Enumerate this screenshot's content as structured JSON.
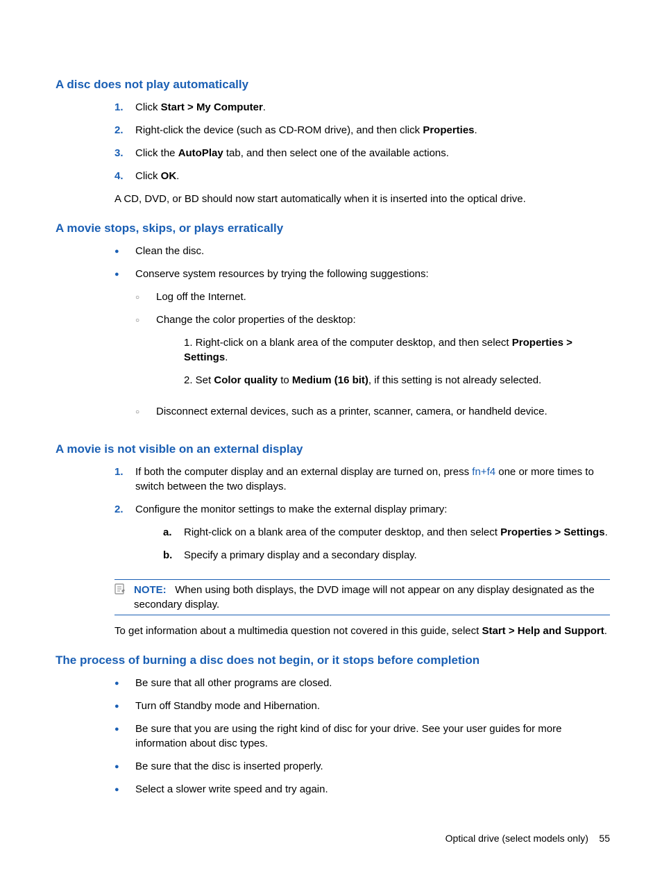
{
  "sections": {
    "s1": {
      "heading": "A disc does not play automatically",
      "steps": {
        "1": {
          "marker": "1.",
          "pre": "Click ",
          "bold": "Start > My Computer",
          "post": "."
        },
        "2": {
          "marker": "2.",
          "pre": "Right-click the device (such as CD-ROM drive), and then click ",
          "bold": "Properties",
          "post": "."
        },
        "3": {
          "marker": "3.",
          "pre": "Click the ",
          "bold": "AutoPlay",
          "post": " tab, and then select one of the available actions."
        },
        "4": {
          "marker": "4.",
          "pre": "Click ",
          "bold": "OK",
          "post": "."
        }
      },
      "after": "A CD, DVD, or BD should now start automatically when it is inserted into the optical drive."
    },
    "s2": {
      "heading": "A movie stops, skips, or plays erratically",
      "bullets": {
        "b1": "Clean the disc.",
        "b2": "Conserve system resources by trying the following suggestions:",
        "sub1": "Log off the Internet.",
        "sub2": "Change the color properties of the desktop:",
        "sub2_1a": "1. Right-click on a blank area of the computer desktop, and then select ",
        "sub2_1b": "Properties > Settings",
        "sub2_1c": ".",
        "sub2_2a": "2. Set ",
        "sub2_2b": "Color quality",
        "sub2_2c": " to ",
        "sub2_2d": "Medium (16 bit)",
        "sub2_2e": ", if this setting is not already selected.",
        "sub3": "Disconnect external devices, such as a printer, scanner, camera, or handheld device."
      }
    },
    "s3": {
      "heading": "A movie is not visible on an external display",
      "steps": {
        "1": {
          "marker": "1.",
          "pre": "If both the computer display and an external display are turned on, press ",
          "link": "fn+f4",
          "post": " one or more times to switch between the two displays."
        },
        "2": {
          "marker": "2.",
          "text": "Configure the monitor settings to make the external display primary:",
          "a": {
            "marker": "a.",
            "pre": "Right-click on a blank area of the computer desktop, and then select ",
            "bold": "Properties > Settings",
            "post": "."
          },
          "b": {
            "marker": "b.",
            "text": "Specify a primary display and a secondary display."
          }
        }
      },
      "note_label": "NOTE:",
      "note_text": "When using both displays, the DVD image will not appear on any display designated as the secondary display.",
      "info_pre": "To get information about a multimedia question not covered in this guide, select ",
      "info_bold": "Start > Help and Support",
      "info_post": "."
    },
    "s4": {
      "heading": "The process of burning a disc does not begin, or it stops before completion",
      "bullets": {
        "b1": "Be sure that all other programs are closed.",
        "b2": "Turn off Standby mode and Hibernation.",
        "b3": "Be sure that you are using the right kind of disc for your drive. See your user guides for more information about disc types.",
        "b4": "Be sure that the disc is inserted properly.",
        "b5": "Select a slower write speed and try again."
      }
    }
  },
  "footer": {
    "text": "Optical drive (select models only)",
    "page": "55"
  }
}
